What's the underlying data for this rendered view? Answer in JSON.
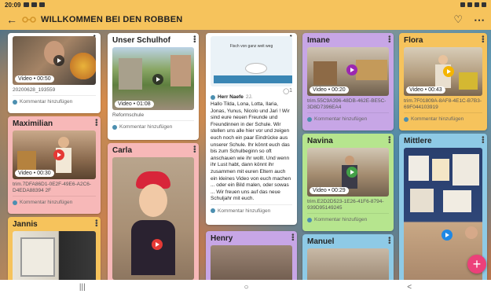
{
  "status": {
    "time": "20:09"
  },
  "appbar": {
    "title": "WILLKOMMEN BEI DEN ROBBEN"
  },
  "comment_label": "Kommentar hinzufügen",
  "colors": {
    "yellow": "#f6c35c",
    "pink": "#f7b8b8",
    "purple": "#c7a6e6",
    "green": "#b6e58e",
    "blue": "#8ecae6",
    "fab": "#ec407a"
  },
  "cards": {
    "video1": {
      "badge": "Video • 00:50",
      "fname": "20200628_193559"
    },
    "schulhof": {
      "title": "Unser Schulhof",
      "badge": "Video • 01:08",
      "fname": "Reformschule"
    },
    "maximilian": {
      "title": "Maximilian",
      "badge": "Video • 00:30",
      "fname": "trim.7DFA86D1-0E2F-49E6-A2C6-D4EDA88394 2F"
    },
    "carla": {
      "title": "Carla"
    },
    "jannis": {
      "title": "Jannis"
    },
    "letter": {
      "image_text": "Fisch von ganz weit weg",
      "author": "Herr Naefe",
      "age": "2J.",
      "reply_count": "1",
      "body": "Hallo Tilda, Lona, Lotta, Ilaria, Jonas, Yunus, Nicolo und Jari ! Wir sind eure neuen Freunde und Freundinnen in der Schule. Wir stellen uns alle hier vor und zeigen euch noch ein paar Eindrücke aus unserer Schule. Ihr könnt euch das bis zum Schulbeginn so oft anschauen wie ihr wollt. Und wenn ihr Lust habt, dann könnt ihr zusammen mit euren Eltern auch ein kleines Video von euch machen ... oder ein Bild malen, oder sowas ... Wir freuen uns auf das neue Schuljahr mit euch."
    },
    "henry": {
      "title": "Henry"
    },
    "imane": {
      "title": "Imane",
      "badge": "Video • 00:20",
      "fname": "trim.55C9A396-48DB-462E-BE5C-3D8D7396EA4"
    },
    "navina": {
      "title": "Navina",
      "badge": "Video • 00:29",
      "fname": "trim.E2D2D523-1E26-41F6-8794-939D95149245"
    },
    "manuel": {
      "title": "Manuel"
    },
    "flora": {
      "title": "Flora",
      "badge": "Video • 00:43",
      "fname": "trim.7F01809A-8AF8-4E1C-B7B3-69F044103919"
    },
    "mittlere": {
      "title": "Mittlere"
    }
  },
  "fab": {
    "label": "+"
  },
  "nav": {
    "recents": "|||",
    "home": "○",
    "back": "<"
  }
}
